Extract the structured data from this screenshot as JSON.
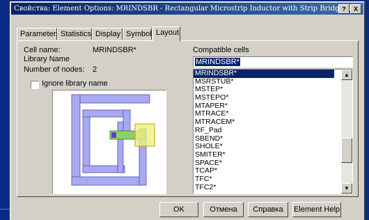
{
  "window": {
    "title": "Свойства: Element Options: MRINDSBR - Rectangular Microstrip Inductor with Strip Bridge (EM Qu...",
    "help_button": "?",
    "close_button": "X"
  },
  "tabs": [
    {
      "label": "Parameters"
    },
    {
      "label": "Statistics"
    },
    {
      "label": "Display"
    },
    {
      "label": "Symbol"
    },
    {
      "label": "Layout"
    }
  ],
  "layout": {
    "cell_name_label": "Cell name:",
    "cell_name_value": "MRINDSBR*",
    "library_name_label": "Library Name",
    "nodes_label": "Number of nodes:",
    "nodes_value": "2",
    "ignore_library_label": "Ignore library name",
    "ignore_library_checked": false
  },
  "compatible": {
    "label": "Compatible cells",
    "current_value": "MRINDSBR*",
    "items": [
      "MRINDSBR*",
      "MSRSTUB*",
      "MSTEP*",
      "MSTEPO*",
      "MTAPER*",
      "MTRACE*",
      "MTRACEM*",
      "RF_Pad",
      "SBEND*",
      "SHOLE*",
      "SMITER*",
      "SPACE*",
      "TCAP*",
      "TFC*",
      "TFC2*"
    ],
    "selected_index": 0,
    "scroll_position": 0.6
  },
  "buttons": {
    "ok": "OK",
    "cancel": "Отмена",
    "help": "Справка",
    "element_help": "Element Help"
  },
  "colors": {
    "trace": "#a9a9f0",
    "bridge": "#f0f080",
    "port": "#6040c0",
    "title_start": "#0a246a"
  }
}
